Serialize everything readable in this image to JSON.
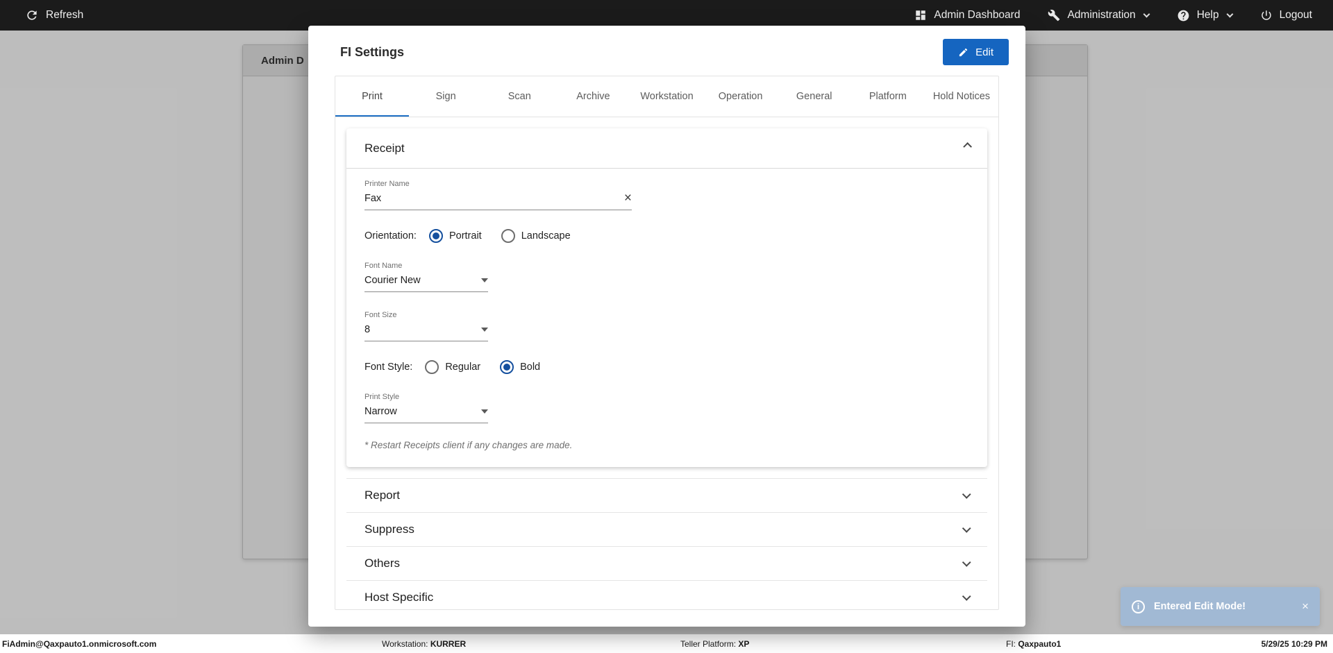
{
  "theme": {
    "accent_blue": "#1565c0",
    "tab_underline": "#1d6fc4",
    "toast_background": "#9eb8d6"
  },
  "topbar": {
    "refresh_label": "Refresh",
    "admin_dashboard_label": "Admin Dashboard",
    "administration_label": "Administration",
    "help_label": "Help",
    "logout_label": "Logout"
  },
  "background": {
    "panel_title": "Admin D"
  },
  "modal": {
    "title": "FI Settings",
    "edit_button_label": "Edit",
    "tabs": [
      {
        "label": "Print",
        "active": true
      },
      {
        "label": "Sign"
      },
      {
        "label": "Scan"
      },
      {
        "label": "Archive"
      },
      {
        "label": "Workstation"
      },
      {
        "label": "Operation"
      },
      {
        "label": "General"
      },
      {
        "label": "Platform"
      },
      {
        "label": "Hold Notices"
      }
    ],
    "receipt": {
      "title": "Receipt",
      "printer_name": {
        "label": "Printer Name",
        "value": "Fax"
      },
      "orientation": {
        "label": "Orientation:",
        "options": [
          "Portrait",
          "Landscape"
        ],
        "selected": "Portrait"
      },
      "font_name": {
        "label": "Font Name",
        "value": "Courier New"
      },
      "font_size": {
        "label": "Font Size",
        "value": "8"
      },
      "font_style": {
        "label": "Font Style:",
        "options": [
          "Regular",
          "Bold"
        ],
        "selected": "Bold"
      },
      "print_style": {
        "label": "Print Style",
        "value": "Narrow"
      },
      "note": "* Restart Receipts client if any changes are made."
    },
    "collapsed_sections": [
      {
        "title": "Report"
      },
      {
        "title": "Suppress"
      },
      {
        "title": "Others"
      },
      {
        "title": "Host Specific"
      }
    ]
  },
  "statusbar": {
    "user": "FiAdmin@Qaxpauto1.onmicrosoft.com",
    "workstation": {
      "label": "Workstation:",
      "value": "KURRER"
    },
    "teller_platform": {
      "label": "Teller Platform:",
      "value": "XP"
    },
    "fi": {
      "label": "FI:",
      "value": "Qaxpauto1"
    },
    "datetime": "5/29/25 10:29 PM"
  },
  "toast": {
    "message": "Entered Edit Mode!"
  }
}
